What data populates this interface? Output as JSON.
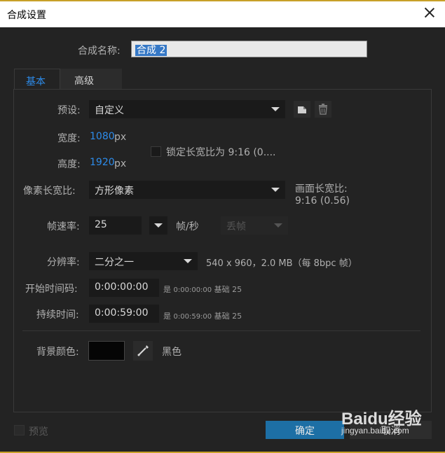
{
  "window": {
    "title": "合成设置"
  },
  "comp_name": {
    "label": "合成名称:",
    "value": "合成 2"
  },
  "tabs": [
    {
      "label": "基本"
    },
    {
      "label": "高级"
    }
  ],
  "preset": {
    "label": "预设:",
    "value": "自定义"
  },
  "width": {
    "label": "宽度:",
    "value": "1080",
    "unit": "px"
  },
  "height": {
    "label": "高度:",
    "value": "1920",
    "unit": "px"
  },
  "lock_aspect": {
    "label": "锁定长宽比为 9:16 (0....",
    "checked": false
  },
  "pixel_aspect": {
    "label": "像素长宽比:",
    "value": "方形像素"
  },
  "frame_aspect": {
    "label": "画面长宽比:",
    "value": "9:16 (0.56)"
  },
  "frame_rate": {
    "label": "帧速率:",
    "value": "25",
    "unit": "帧/秒",
    "drop_frame": "丢帧"
  },
  "resolution": {
    "label": "分辨率:",
    "value": "二分之一",
    "info": "540 x 960，2.0 MB（每 8bpc 帧）"
  },
  "start_timecode": {
    "label": "开始时间码:",
    "value": "0:00:00:00",
    "is": "是",
    "code": "0:00:00:00",
    "base": "基础 25"
  },
  "duration": {
    "label": "持续时间:",
    "value": "0:00:59:00",
    "is": "是",
    "code": "0:00:59:00",
    "base": "基础 25"
  },
  "background": {
    "label": "背景颜色:",
    "color_name": "黑色",
    "color": "#050505"
  },
  "preview": {
    "label": "预览",
    "checked": false
  },
  "buttons": {
    "ok": "确定",
    "cancel": "取消"
  },
  "watermark": {
    "brand": "Baidu经验",
    "url": "jingyan.baidu.com"
  },
  "colors": {
    "accent": "#2d8ceb",
    "ok_button": "#1d6fa5",
    "titlebar_border": "#c8a028"
  }
}
